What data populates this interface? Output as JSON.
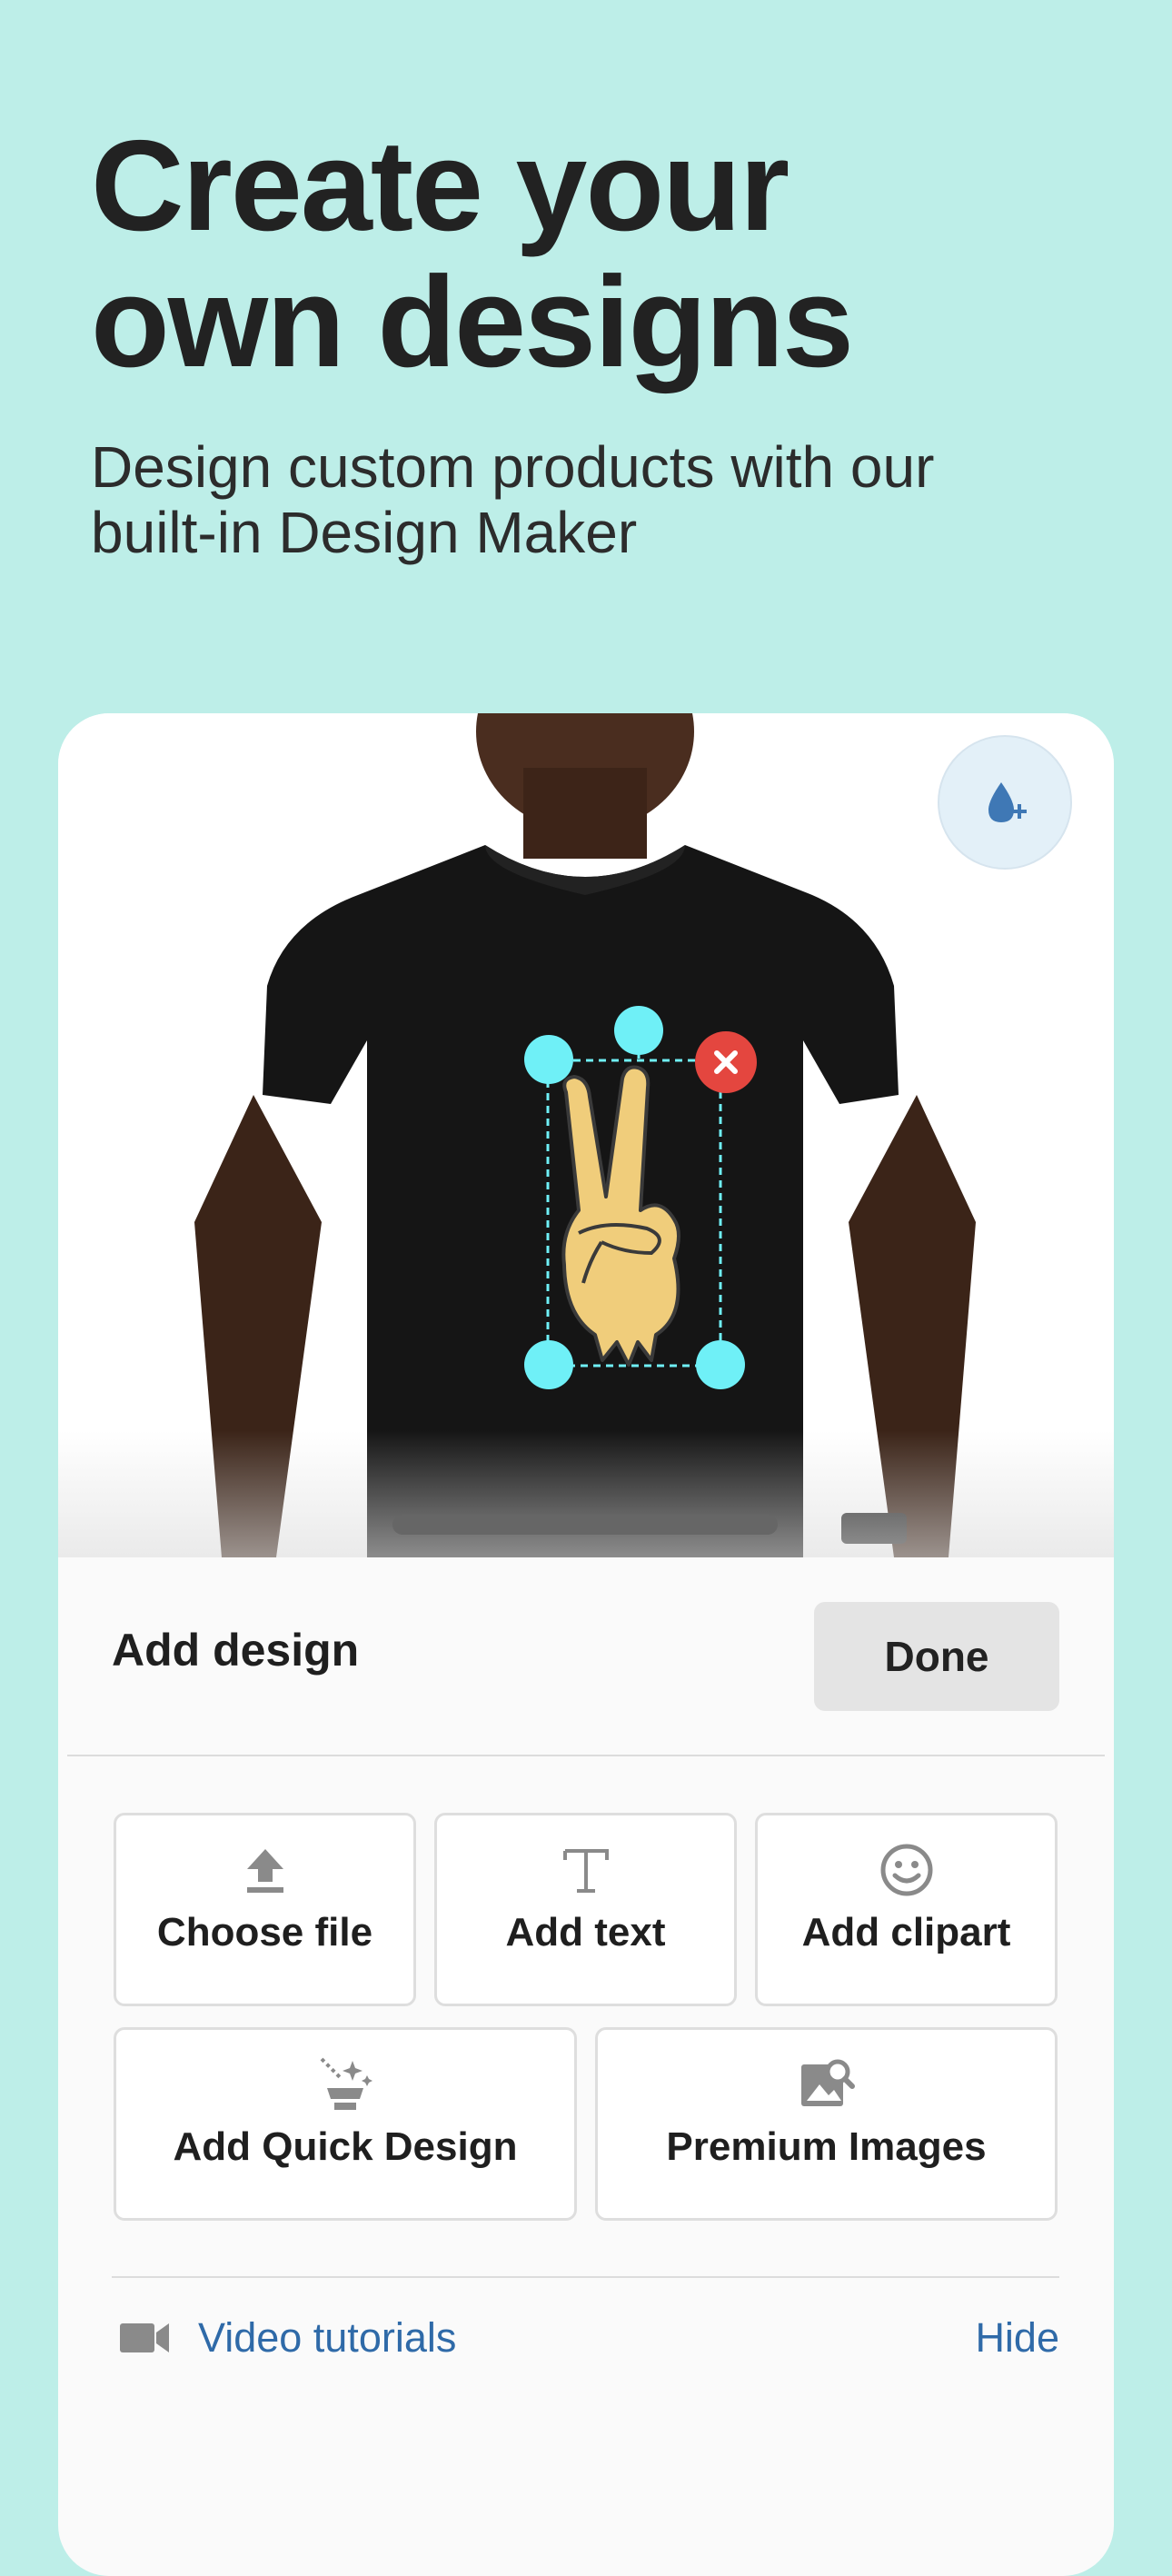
{
  "hero": {
    "title_line1": "Create your",
    "title_line2": "own designs",
    "subtitle_line1": "Design custom products with our",
    "subtitle_line2": "built-in Design Maker"
  },
  "panel": {
    "title": "Add design",
    "done_label": "Done"
  },
  "tools": {
    "choose_file": "Choose file",
    "add_text": "Add text",
    "add_clipart": "Add clipart",
    "add_quick_design": "Add Quick Design",
    "premium_images": "Premium Images"
  },
  "footer": {
    "video_tutorials": "Video tutorials",
    "hide": "Hide"
  },
  "colors": {
    "background": "#bdeee8",
    "link": "#2f6aa8",
    "handle": "#6ff0f7",
    "delete": "#e4463f"
  },
  "icons": [
    "upload-icon",
    "text-icon",
    "smiley-icon",
    "magic-wand-icon",
    "image-search-icon",
    "video-camera-icon",
    "color-drop-plus-icon",
    "close-icon"
  ]
}
